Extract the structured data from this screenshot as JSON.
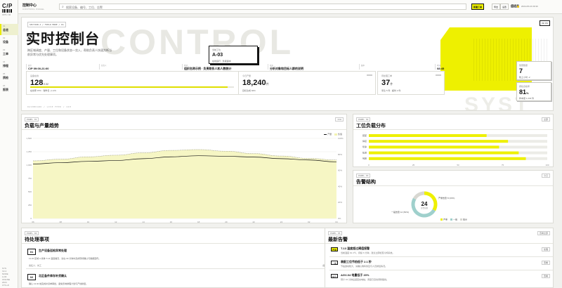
{
  "app": {
    "logo": "C/P",
    "logo_sub": "OPS / 02",
    "title": "控制中心",
    "subtitle": "CONTROL PANEL"
  },
  "sidebar": {
    "items": [
      {
        "num": "01",
        "label": "总览",
        "active": true
      },
      {
        "num": "02",
        "label": "设备",
        "active": false
      },
      {
        "num": "03",
        "label": "工单",
        "active": false
      },
      {
        "num": "04",
        "label": "排程",
        "active": false
      },
      {
        "num": "05",
        "label": "质检",
        "active": false
      },
      {
        "num": "06",
        "label": "报表",
        "active": false
      }
    ],
    "footer": [
      "SYS",
      "V2.4",
      "NODE",
      "A-03",
      "ONLINE",
      "2024",
      "UTC+8",
      "OPS"
    ]
  },
  "topbar": {
    "search_placeholder": "搜索设备、编号、工位、告警",
    "btn_primary": "新建工单",
    "btn_2": "导出",
    "btn_3": "设置",
    "user": "值班员",
    "time": "2024-05-16 09:30"
  },
  "hero": {
    "code": "SECTION A / FIELD MODE / 01",
    "title": "实时控制台",
    "ghost": "CONTROL",
    "ghost2": "SYST",
    "desc": "跨区域调度、产量、工位和设备状态一览入，帮助负责人快速判断当前异常与优先处理事项。",
    "tag": "V2.01",
    "float": {
      "k": "当前工位",
      "v": "A-03",
      "s": "在线运行 · 负载适中"
    },
    "info": [
      {
        "k": "班次",
        "v": "C/P 09:00-21:00"
      },
      {
        "k": "负责人",
        "v": ""
      },
      {
        "k": "区域",
        "v": "组织名称示例 · 负责联系人和人数统计"
      },
      {
        "k": "状态",
        "v": "分析对象和目标人群的说明"
      },
      {
        "k": "版本",
        "v": ""
      },
      {
        "k": "时间",
        "v": "08:45"
      }
    ],
    "kpis": [
      {
        "k": "设备在线",
        "v": "128",
        "unit": "/132",
        "s": "在线率 97% · 较昨日 +1.2%",
        "progress": 0.97
      },
      {
        "k": "今日产量",
        "v": "18,240",
        "unit": "件",
        "s": "目标达成 92%",
        "progress": null
      },
      {
        "k": "待处理工单",
        "v": "37",
        "unit": "件",
        "s": "紧急 5 件 · 超时 2 件",
        "progress": null
      }
    ],
    "side_kpis": [
      {
        "k": "告警数量",
        "v": "7",
        "unit": "",
        "s": "较上小时 -2"
      },
      {
        "k": "质检合格率",
        "v": "81",
        "unit": "%",
        "s": "样本量 1,240 件"
      }
    ],
    "footer": "DASHBOARD / LIVE FEED / 24H"
  },
  "chart_panel": {
    "code": "PANEL 01",
    "title": "负载与产量趋势",
    "btn": "24H",
    "legend": [
      "产量",
      "负载"
    ]
  },
  "chart_data": {
    "type": "area",
    "title": "负载与产量趋势",
    "x": [
      "06",
      "08",
      "10",
      "12",
      "14",
      "16",
      "18",
      "20",
      "22",
      "24",
      "02",
      "04"
    ],
    "series": [
      {
        "name": "产量",
        "values": [
          1020,
          1045,
          1070,
          1085,
          1120,
          1155,
          1175,
          1165,
          1150,
          1120,
          1095,
          1060
        ]
      },
      {
        "name": "负载",
        "values": [
          72,
          74,
          77,
          79,
          82,
          85,
          86,
          84,
          81,
          78,
          75,
          73
        ]
      }
    ],
    "y_left_ticks": [
      "1,500",
      "1,250",
      "1,000",
      "750",
      "500",
      "250",
      "0"
    ],
    "y_right_ticks": [
      "100%",
      "80%",
      "60%",
      "40%",
      "20%",
      "0%"
    ],
    "ylim_left": [
      0,
      1500
    ],
    "ylim_right": [
      0,
      100
    ]
  },
  "workload": {
    "code": "PANEL 02",
    "title": "工位负载分布",
    "btn": "全部",
    "type": "bar",
    "categories": [
      "装配",
      "焊接",
      "喷涂",
      "检测",
      "包装"
    ],
    "values": [
      66,
      78,
      73,
      84,
      88
    ],
    "ticks": [
      "0",
      "25",
      "50",
      "75",
      "100"
    ]
  },
  "alerts_struct": {
    "code": "PANEL 03",
    "title": "告警结构",
    "btn": "今日",
    "total": "24",
    "total_label": "告警总数",
    "slices": [
      {
        "name": "严重",
        "value": 8,
        "color": "#eef000"
      },
      {
        "name": "一般",
        "value": 12,
        "color": "#9fd0cc"
      },
      {
        "name": "提示",
        "value": 4,
        "color": "#d8d8d2"
      }
    ],
    "callouts": [
      "一般告警 12 (50%)",
      "严重告警 8 (33%)"
    ]
  },
  "todo_panel": {
    "code": "PANEL 04",
    "title": "待处理事项",
    "btn": "查看全部",
    "items": [
      {
        "num": "01",
        "title": "生产设备巡检异常处理",
        "desc": "11:20 区域 A 线体 T-14 温度偏高，请在 30 分钟内完成现场确认与数据回传。",
        "badge": "紧急",
        "badge_yellow": true,
        "f1": "责任人：刘工",
        "f2": "截止 11:50 · 待处理"
      },
      {
        "num": "02",
        "title": "北区备件库存补货确认",
        "desc": "确认 13:30 前完成补货单审批，避免影响排程计划与产线换型。",
        "badge": "一般",
        "badge_yellow": false,
        "f1": "",
        "f2": ""
      }
    ]
  },
  "alert_panel": {
    "code": "PANEL 05",
    "title": "最新告警",
    "btn": "查看全部",
    "items": [
      {
        "level": "严重",
        "yellow": true,
        "title": "T-13 温度超过阈值报警",
        "desc": "当前温度 91.4℃，持续 6 分钟，建议立即检查冷却系统。",
        "btn": "处理"
      },
      {
        "level": "一般",
        "yellow": false,
        "title": "装配工位节拍低于 2.1 秒",
        "desc": "节拍波动较大，请确认物料供应与人员排班情况。",
        "btn": "查看"
      },
      {
        "level": "提示",
        "yellow": false,
        "title": "AGV-04 电量低于 20%",
        "desc": "预计 15 分钟后返回充电桩，调度已自动调整路线。",
        "btn": "查看"
      }
    ]
  }
}
